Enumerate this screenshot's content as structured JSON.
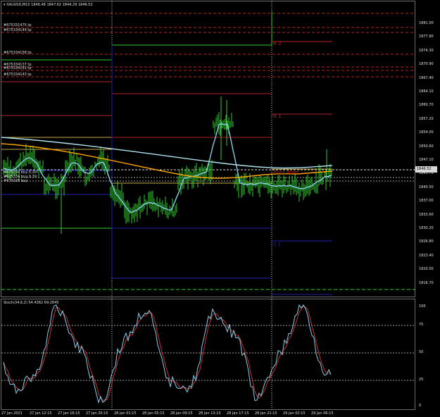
{
  "chart": {
    "symbol_title": "XAUUSD,M15",
    "ohlc": "1846.48 1847.62 1844.29 1846.52",
    "current_price": "1846.52",
    "stoch_title": "Stoch(34,6,2) 54.4362 69.2845"
  },
  "price_axis": [
    "1881.00",
    "1877.80",
    "1874.30",
    "1870.90",
    "1867.40",
    "1864.10",
    "1860.70",
    "1857.20",
    "1854.00",
    "1850.60",
    "1847.10",
    "1843.70",
    "1840.50",
    "1837.00",
    "1833.60",
    "1830.20",
    "1826.80",
    "1823.40",
    "1820.00",
    "1816.70"
  ],
  "osc_axis": [
    "100",
    "75",
    "50",
    "25",
    "0"
  ],
  "time_axis": [
    "27 Jan 2021",
    "27 Jan 12:15",
    "27 Jan 16:15",
    "27 Jan 20:15",
    "28 Jan 01:15",
    "28 Jan 05:15",
    "28 Jan 09:15",
    "28 Jan 13:15",
    "28 Jan 17:15",
    "28 Jan 21:15",
    "29 Jan 02:15",
    "29 Jan 06:15"
  ],
  "order_labels": [
    "#675331475 tp",
    "#675334149 tp",
    "#675334158 tp",
    "#675334137 tp",
    "#675334191 tp",
    "#675334143 tp",
    "#675334 buy 0.30",
    "#675334 buy 0.30",
    "#675335 buy"
  ],
  "pivot_labels": {
    "r2": "R 2",
    "r1": "R 1",
    "pp": "Pivot Point",
    "s1": "S 1"
  },
  "colors": {
    "candles": "#32cd32",
    "sma_fast": "#87ceeb",
    "sma_slow": "#ffa500",
    "resistance": "#b22222",
    "support": "#1e1eb4",
    "stoch_main": "#87ceeb",
    "stoch_signal": "#c83232",
    "grid": "#d8d8d8"
  }
}
